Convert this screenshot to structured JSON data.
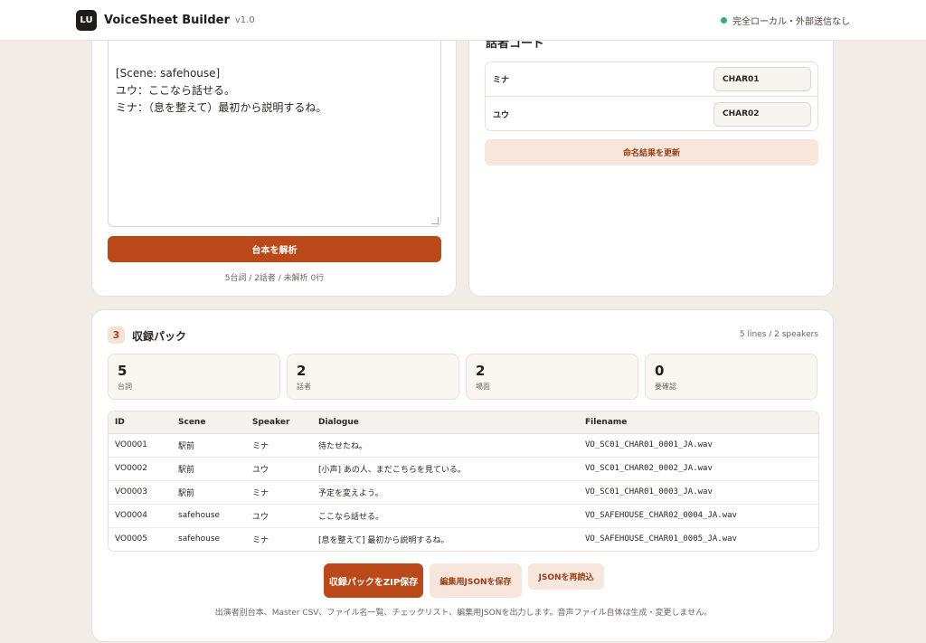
{
  "header": {
    "logo_text": "LU",
    "title": "VoiceSheet Builder",
    "version": "v1.0",
    "status": "完全ローカル・外部送信なし"
  },
  "script": {
    "lines": "[Scene: safehouse]\nユウ：ここなら話せる。\nミナ：（息を整えて）最初から説明するね。",
    "parse_button": "台本を解析",
    "stats": "5台詞 / 2話者 / 未解析 0行"
  },
  "speakers": {
    "heading": "話者コード",
    "items": [
      {
        "name": "ミナ",
        "code": "CHAR01"
      },
      {
        "name": "ユウ",
        "code": "CHAR02"
      }
    ],
    "update_button": "命名結果を更新"
  },
  "pack": {
    "number": "3",
    "title": "収録パック",
    "meta": "5 lines / 2 speakers",
    "stats": [
      {
        "value": "5",
        "label": "台詞"
      },
      {
        "value": "2",
        "label": "話者"
      },
      {
        "value": "2",
        "label": "場面"
      },
      {
        "value": "0",
        "label": "要確認"
      }
    ],
    "columns": [
      "ID",
      "Scene",
      "Speaker",
      "Dialogue",
      "Filename"
    ],
    "rows": [
      {
        "id": "VO0001",
        "scene": "駅前",
        "speaker": "ミナ",
        "dialogue": "待たせたね。",
        "filename": "VO_SC01_CHAR01_0001_JA.wav"
      },
      {
        "id": "VO0002",
        "scene": "駅前",
        "speaker": "ユウ",
        "dialogue": "[小声] あの人、まだこちらを見ている。",
        "filename": "VO_SC01_CHAR02_0002_JA.wav"
      },
      {
        "id": "VO0003",
        "scene": "駅前",
        "speaker": "ミナ",
        "dialogue": "予定を変えよう。",
        "filename": "VO_SC01_CHAR01_0003_JA.wav"
      },
      {
        "id": "VO0004",
        "scene": "safehouse",
        "speaker": "ユウ",
        "dialogue": "ここなら話せる。",
        "filename": "VO_SAFEHOUSE_CHAR02_0004_JA.wav"
      },
      {
        "id": "VO0005",
        "scene": "safehouse",
        "speaker": "ミナ",
        "dialogue": "[息を整えて] 最初から説明するね。",
        "filename": "VO_SAFEHOUSE_CHAR01_0005_JA.wav"
      }
    ],
    "zip_button": "収録パックをZIP保存",
    "save_json_button": "編集用JSONを保存",
    "reload_json_button": "JSONを再読込",
    "note": "出演者別台本、Master CSV、ファイル名一覧、チェックリスト、編集用JSONを出力します。音声ファイル自体は生成・変更しません。"
  },
  "colors": {
    "accent": "#bb4818",
    "accent_soft": "#f6e6dc",
    "status_ok": "#2fb26a",
    "background": "#f1ede6"
  }
}
